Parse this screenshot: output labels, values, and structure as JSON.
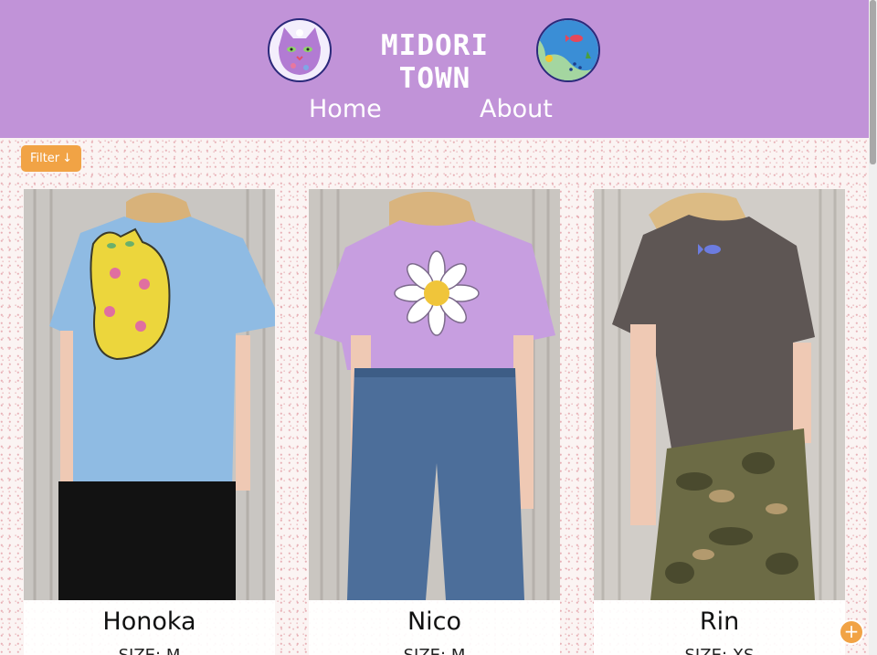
{
  "header": {
    "title": "MIDORI TOWN",
    "logo_left_icon": "cat-face-icon",
    "logo_right_icon": "fish-pond-icon",
    "nav": [
      {
        "label": "Home"
      },
      {
        "label": "About"
      }
    ]
  },
  "filter": {
    "label": "Filter",
    "icon": "arrow-down-icon"
  },
  "products": [
    {
      "name": "Honoka",
      "size": "SIZE: M",
      "shirt_color": "#8fbbe3",
      "design": "yellow cat with pink flowers"
    },
    {
      "name": "Nico",
      "size": "SIZE: M",
      "shirt_color": "#c79ee0",
      "design": "white daisy with yellow cat"
    },
    {
      "name": "Rin",
      "size": "SIZE: XS",
      "shirt_color": "#5e5654",
      "design": "small blue fish"
    }
  ],
  "fab": {
    "icon": "plus-icon"
  },
  "colors": {
    "header_bg": "#c193d8",
    "accent": "#f1a345",
    "page_bg": "#fbf4f3"
  }
}
